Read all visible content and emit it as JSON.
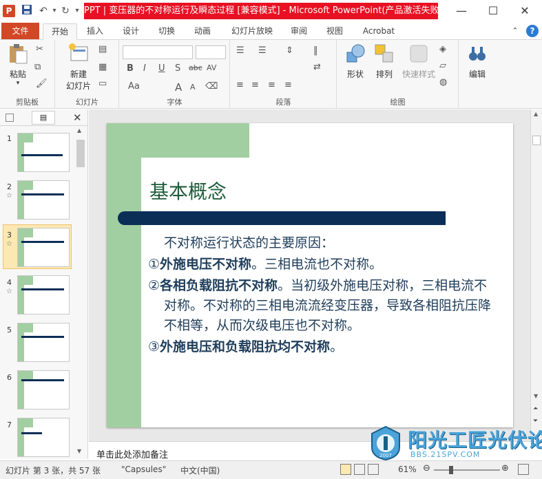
{
  "window": {
    "title": "PPT | 变压器的不对称运行及瞬态过程 [兼容模式] - Microsoft PowerPoint(产品激活失败)",
    "logo_letter": "P",
    "minimize": "—",
    "restore": "☐",
    "close": "✕"
  },
  "qat": {
    "save": "💾",
    "undo": "↶",
    "redo": "↻"
  },
  "tabs": {
    "file": "文件",
    "items": [
      "开始",
      "插入",
      "设计",
      "切换",
      "动画",
      "幻灯片放映",
      "审阅",
      "视图",
      "Acrobat"
    ],
    "active_index": 0
  },
  "ribbon": {
    "clipboard": {
      "label": "剪贴板",
      "paste": "粘贴"
    },
    "slides": {
      "label": "幻灯片",
      "new_slide": "新建",
      "new_slide_2": "幻灯片"
    },
    "font": {
      "label": "字体",
      "bold": "B",
      "italic": "I",
      "underline": "U",
      "shadow": "S",
      "strike": "abc",
      "spacing": "AV",
      "case": "Aa",
      "grow": "A",
      "shrink": "A"
    },
    "paragraph": {
      "label": "段落"
    },
    "drawing": {
      "label": "绘图",
      "shapes": "形状",
      "arrange": "排列",
      "quick_styles": "快速样式"
    },
    "editing": {
      "label": "",
      "edit": "编辑"
    }
  },
  "thumbnails": [
    {
      "num": "1",
      "star": ""
    },
    {
      "num": "2",
      "star": "☆"
    },
    {
      "num": "3",
      "star": "☆"
    },
    {
      "num": "4",
      "star": "☆"
    },
    {
      "num": "5",
      "star": ""
    },
    {
      "num": "6",
      "star": ""
    },
    {
      "num": "7",
      "star": ""
    }
  ],
  "selected_slide": 3,
  "slide": {
    "title": "基本概念",
    "intro": "不对称运行状态的主要原因：",
    "p1_num": "①",
    "p1_bold": "外施电压不对称",
    "p1_rest": "。三相电流也不对称。",
    "p2_num": "②",
    "p2_bold": "各相负载阻抗不对称",
    "p2_rest": "。当初级外施电压对称，三相电流不对称。不对称的三相电流流经变压器，导致各相阻抗压降不相等，从而次级电压也不对称。",
    "p3_num": "③",
    "p3_bold": "外施电压和负载阻抗均不对称",
    "p3_rest": "。"
  },
  "notes": {
    "placeholder": "单击此处添加备注"
  },
  "status": {
    "slide_info": "幻灯片 第 3 张，共 57 张",
    "theme": "\"Capsules\"",
    "language": "中文(中国)",
    "zoom": "61%"
  },
  "watermark": {
    "name": "阳光工匠光伏论坛",
    "url": "BBS.21SPV.COM",
    "year": "2007"
  },
  "colors": {
    "file_tab": "#d24726",
    "title_highlight": "#e81123",
    "slide_green": "#a2cfa1",
    "slide_navy": "#0b2e57",
    "title_green": "#1e5c3a"
  }
}
